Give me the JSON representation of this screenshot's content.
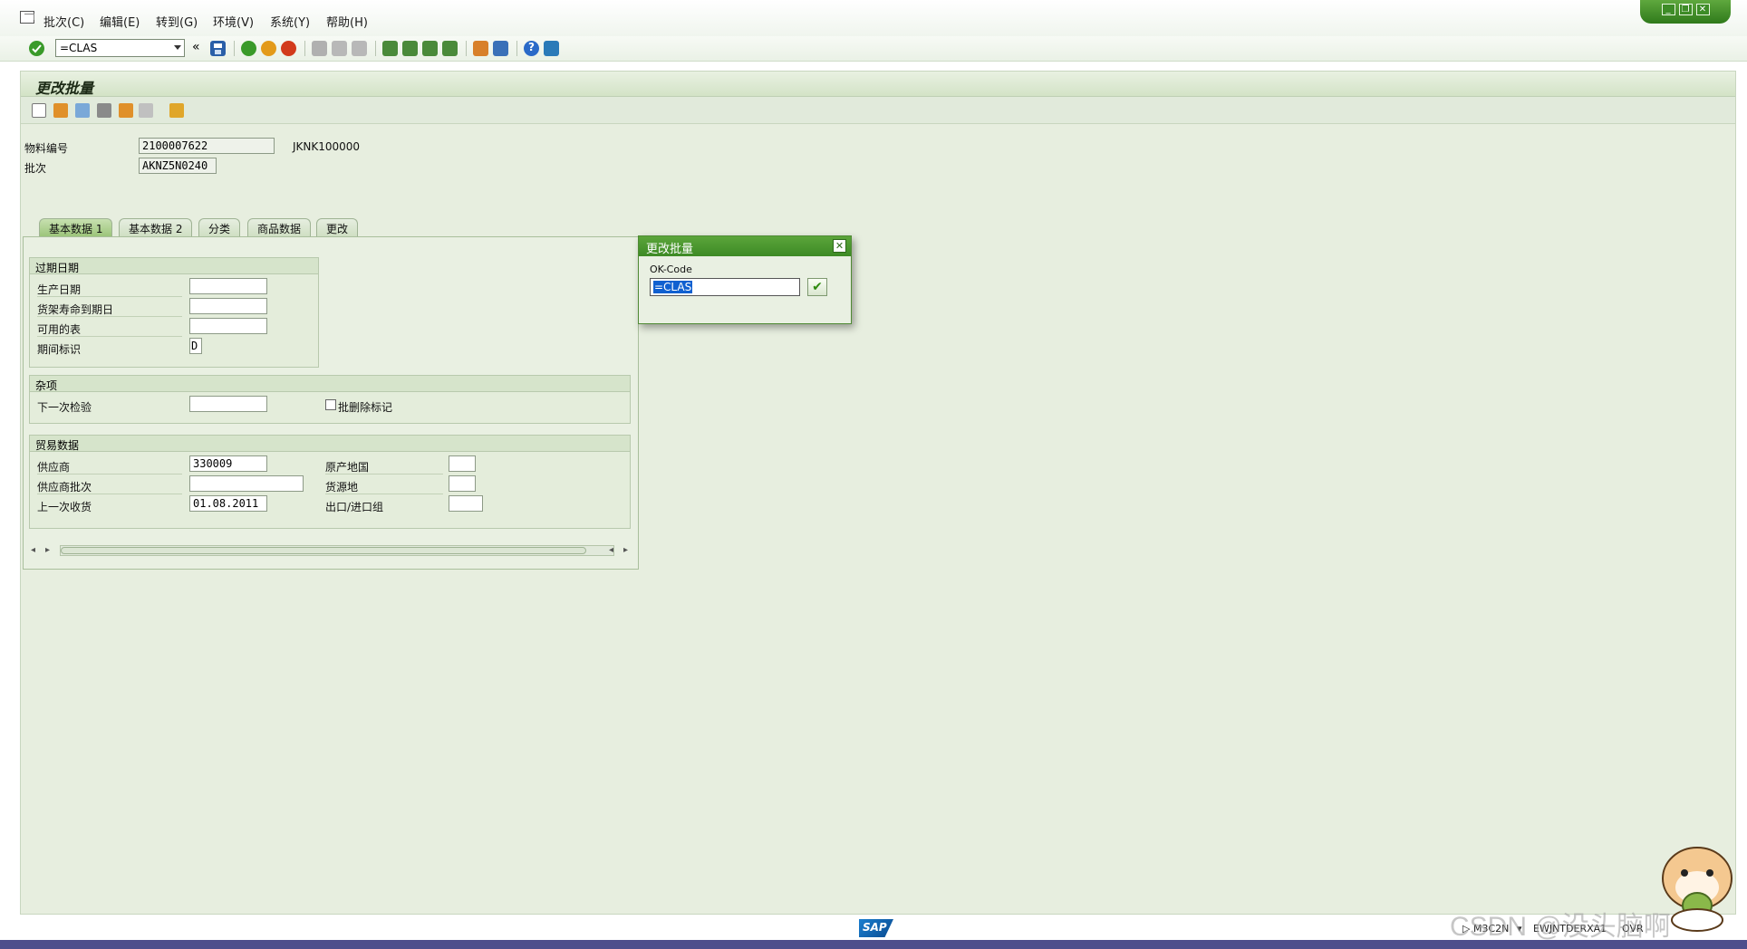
{
  "menu": [
    "批次(C)",
    "编辑(E)",
    "转到(G)",
    "环境(V)",
    "系统(Y)",
    "帮助(H)"
  ],
  "command_field": {
    "value": "=CLAS"
  },
  "page_title": "更改批量",
  "header": {
    "material_label": "物料编号",
    "material_value": "2100007622",
    "material_desc": "JKNK100000",
    "batch_label": "批次",
    "batch_value": "AKNZ5N0240"
  },
  "tabs": [
    "基本数据 1",
    "基本数据 2",
    "分类",
    "商品数据",
    "更改"
  ],
  "group_expiry": {
    "title": "过期日期",
    "rows": [
      "生产日期",
      "货架寿命到期日",
      "可用的表",
      "期间标识"
    ],
    "period_value": "D"
  },
  "group_misc": {
    "title": "杂项",
    "next_inspection_label": "下一次检验",
    "deletion_flag_label": "批删除标记"
  },
  "group_trade": {
    "title": "贸易数据",
    "vendor_label": "供应商",
    "vendor_value": "330009",
    "vendor_batch_label": "供应商批次",
    "last_receipt_label": "上一次收货",
    "last_receipt_value": "01.08.2011",
    "country_label": "原产地国",
    "region_label": "货源地",
    "export_group_label": "出口/进口组"
  },
  "popup": {
    "title": "更改批量",
    "field_label": "OK-Code",
    "field_value": "=CLAS"
  },
  "status": {
    "tcode": "M3C2N",
    "server": "EWJNTDERXA1",
    "mode": "OVR"
  },
  "sap_logo": "SAP",
  "watermark": "CSDN @没头脑啊"
}
